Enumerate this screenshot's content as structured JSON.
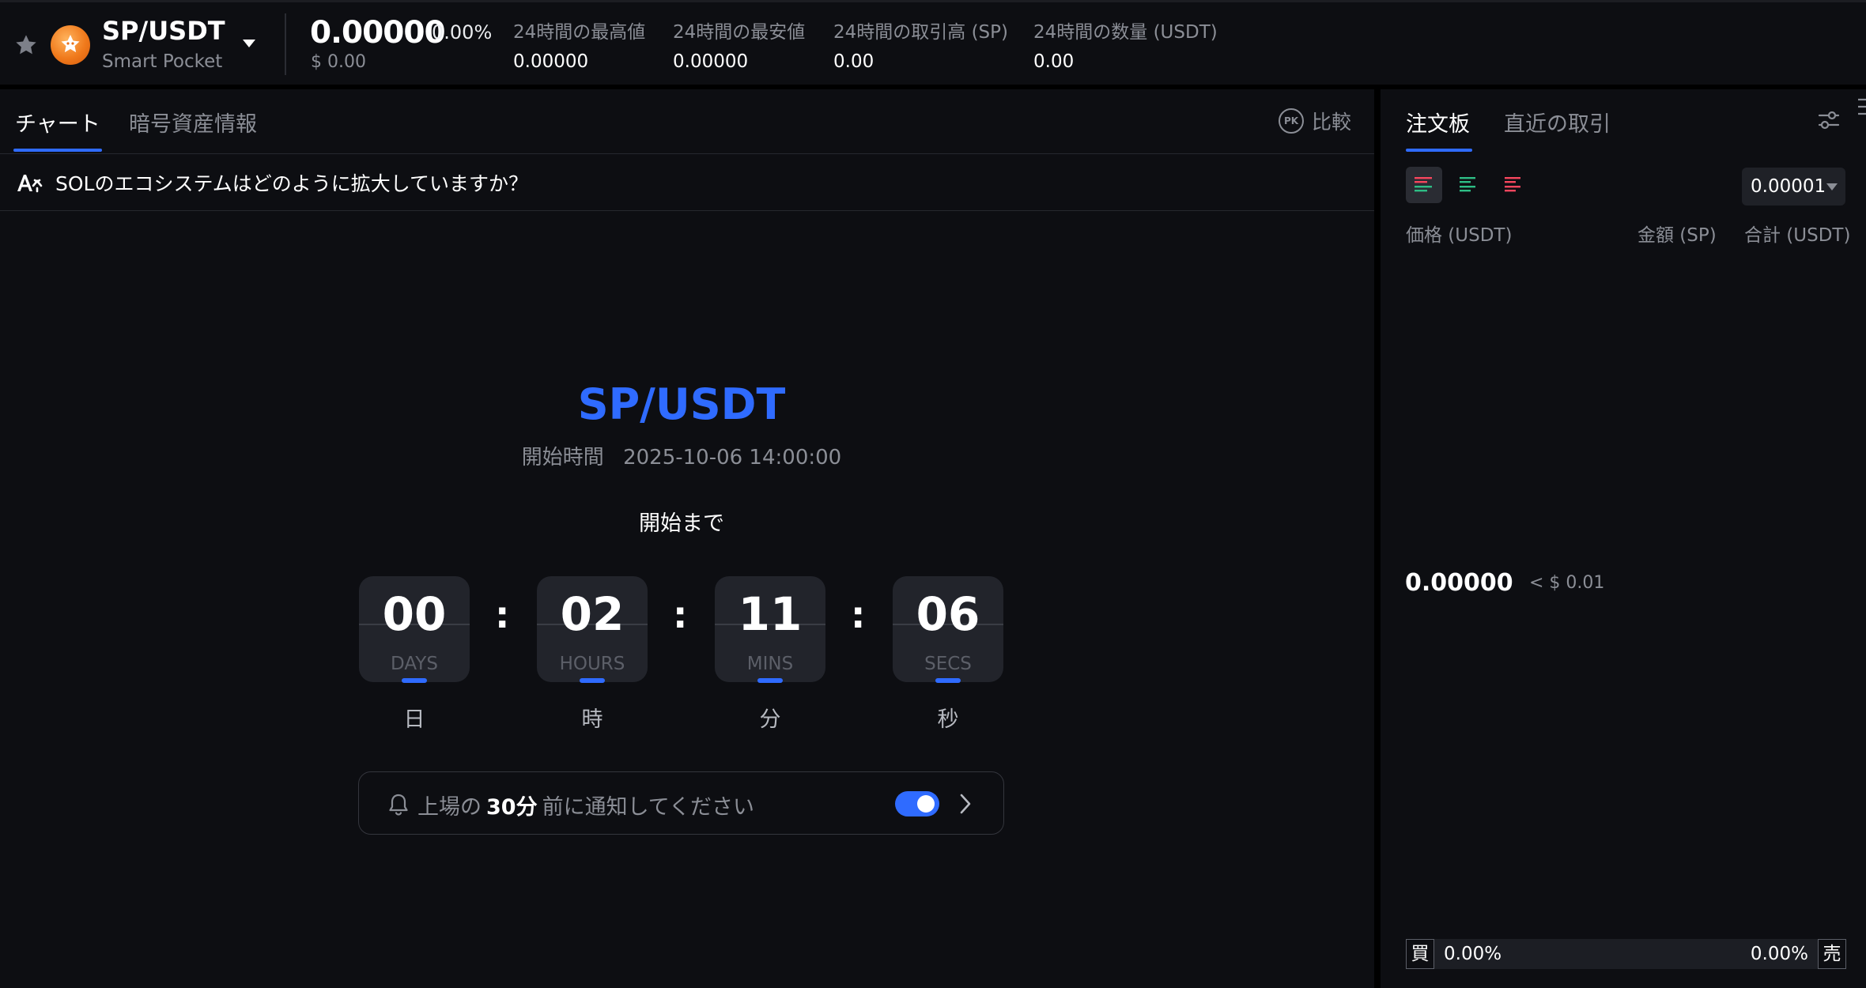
{
  "header": {
    "pair": "SP/USDT",
    "token_name": "Smart Pocket",
    "last_price": "0.00000",
    "change_pct": "0.00%",
    "price_usd": "$ 0.00",
    "stats": [
      {
        "label": "24時間の最高値",
        "value": "0.00000"
      },
      {
        "label": "24時間の最安値",
        "value": "0.00000"
      },
      {
        "label": "24時間の取引高 (SP)",
        "value": "0.00"
      },
      {
        "label": "24時間の数量 (USDT)",
        "value": "0.00"
      }
    ]
  },
  "chart_panel": {
    "tabs": [
      {
        "label": "チャート",
        "active": true
      },
      {
        "label": "暗号資産情報",
        "active": false
      }
    ],
    "compare_icon_text": "PK",
    "compare_label": "比較",
    "ai_question": "SOLのエコシステムはどのように拡大していますか？",
    "countdown": {
      "pair": "SP/USDT",
      "start_label": "開始時間",
      "start_time": "2025-10-06 14:00:00",
      "until_label": "開始まで",
      "units": [
        {
          "value": "00",
          "unit": "DAYS",
          "caption": "日"
        },
        {
          "value": "02",
          "unit": "HOURS",
          "caption": "時"
        },
        {
          "value": "11",
          "unit": "MINS",
          "caption": "分"
        },
        {
          "value": "06",
          "unit": "SECS",
          "caption": "秒"
        }
      ],
      "separator": ":"
    },
    "notify": {
      "prefix": "上場の",
      "highlight": "30分",
      "suffix": "前に通知してください",
      "enabled": true
    }
  },
  "orderbook": {
    "tabs": [
      {
        "label": "注文板",
        "active": true
      },
      {
        "label": "直近の取引",
        "active": false
      }
    ],
    "precision": "0.00001",
    "columns": {
      "price": "価格 (USDT)",
      "amount": "金額 (SP)",
      "total": "合計 (USDT)"
    },
    "mid_price": "0.00000",
    "mid_price_usd": "< $ 0.01",
    "ratio": {
      "buy_label": "買",
      "buy_pct": "0.00%",
      "sell_label": "売",
      "sell_pct": "0.00%"
    }
  },
  "colors": {
    "accent": "#2f6bff",
    "buy": "#2ebd85",
    "sell": "#f6465d",
    "background": "#0d0e12"
  },
  "icons": [
    "star-icon",
    "token-logo",
    "chevron-down-icon",
    "compare-icon",
    "ai-icon",
    "bell-icon",
    "chevron-right-icon",
    "settings-sliders-icon",
    "orderbook-both-icon",
    "orderbook-buy-icon",
    "orderbook-sell-icon"
  ]
}
